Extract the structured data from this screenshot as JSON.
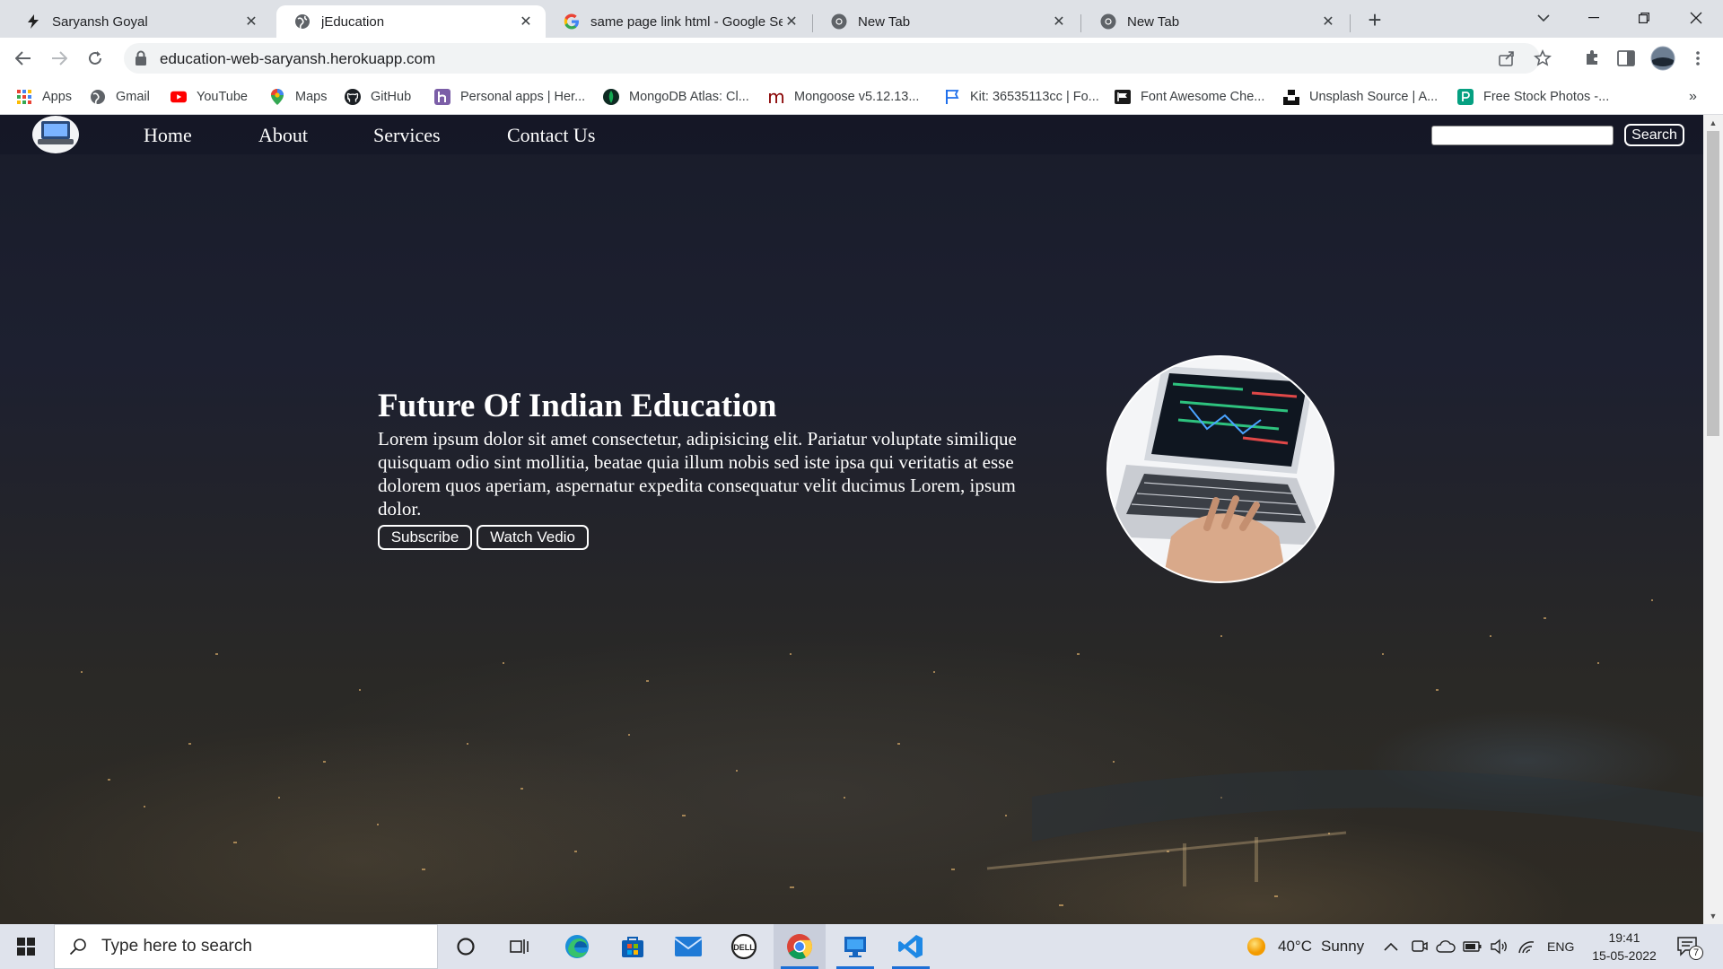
{
  "browser": {
    "tabs": [
      {
        "title": "Saryansh Goyal",
        "active": false,
        "favicon": "saryansh-favicon"
      },
      {
        "title": "jEducation",
        "active": true,
        "favicon": "globe-favicon"
      },
      {
        "title": "same page link html - Google Se",
        "active": false,
        "favicon": "google-favicon"
      },
      {
        "title": "New Tab",
        "active": false,
        "favicon": "chrome-favicon"
      },
      {
        "title": "New Tab",
        "active": false,
        "favicon": "chrome-favicon"
      }
    ],
    "url": "education-web-saryansh.herokuapp.com",
    "bookmarks": [
      {
        "label": "Apps",
        "icon": "apps-grid-icon"
      },
      {
        "label": "Gmail",
        "icon": "globe-icon"
      },
      {
        "label": "YouTube",
        "icon": "youtube-icon"
      },
      {
        "label": "Maps",
        "icon": "maps-pin-icon"
      },
      {
        "label": "GitHub",
        "icon": "github-icon"
      },
      {
        "label": "Personal apps | Her...",
        "icon": "heroku-icon"
      },
      {
        "label": "MongoDB Atlas: Cl...",
        "icon": "mongodb-leaf-icon"
      },
      {
        "label": "Mongoose v5.12.13...",
        "icon": "mongoose-icon"
      },
      {
        "label": "Kit: 36535113cc | Fo...",
        "icon": "flag-icon"
      },
      {
        "label": "Font Awesome Che...",
        "icon": "font-awesome-icon"
      },
      {
        "label": "Unsplash Source | A...",
        "icon": "unsplash-icon"
      },
      {
        "label": "Free Stock Photos -...",
        "icon": "pexels-icon"
      }
    ]
  },
  "site": {
    "nav": [
      {
        "label": "Home"
      },
      {
        "label": "About"
      },
      {
        "label": "Services"
      },
      {
        "label": "Contact Us"
      }
    ],
    "search_button": "Search",
    "search_value": "",
    "hero": {
      "title": "Future Of Indian Education",
      "text": "Lorem ipsum dolor sit amet consectetur, adipisicing elit. Pariatur voluptate similique quisquam odio sint mollitia, beatae quia illum nobis sed iste ipsa qui veritatis at esse dolorem quos aperiam, aspernatur expedita consequatur velit ducimus Lorem, ipsum dolor.",
      "buttons": [
        {
          "label": "Subscribe"
        },
        {
          "label": "Watch Vedio"
        }
      ]
    }
  },
  "taskbar": {
    "search_placeholder": "Type here to search",
    "weather": {
      "temp": "40°C",
      "condition": "Sunny"
    },
    "language": "ENG",
    "time": "19:41",
    "date": "15-05-2022",
    "notification_count": "7",
    "apps": [
      "cortana-icon",
      "task-view-icon",
      "edge-icon",
      "microsoft-store-icon",
      "mail-icon",
      "dell-icon",
      "chrome-icon",
      "remote-desktop-icon",
      "vscode-icon"
    ]
  },
  "colors": {
    "chrome_bg": "#dee1e6",
    "nav_bg": "#141626",
    "hero_text": "#ffffff",
    "taskbar_bg": "#dfe3ec",
    "accent_blue": "#1d6fd6"
  }
}
